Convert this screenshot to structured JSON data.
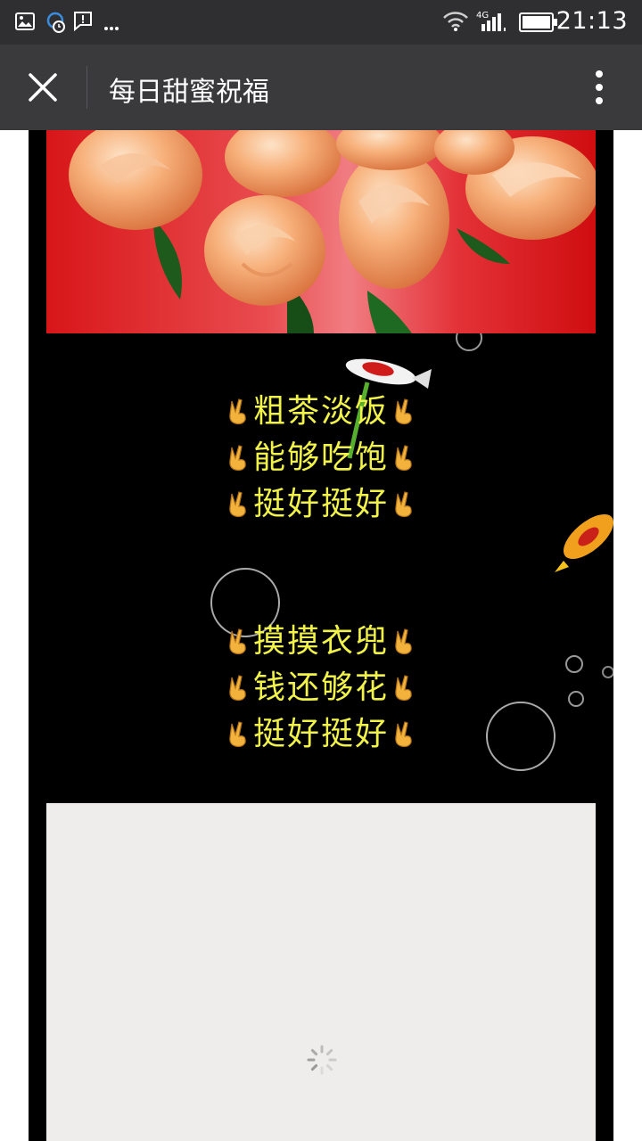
{
  "status_bar": {
    "time": "21:13",
    "network": "4G",
    "left_icons": [
      "image-icon",
      "sync-icon",
      "message-icon",
      "more-dots-icon"
    ],
    "right_icons": [
      "wifi-icon",
      "signal-icon",
      "battery-icon"
    ]
  },
  "nav": {
    "title": "每日甜蜜祝福",
    "close_icon": "close-icon",
    "more_icon": "vertical-dots-icon"
  },
  "poem": {
    "stanza1": [
      "粗茶淡饭",
      "能够吃饱",
      "挺好挺好"
    ],
    "stanza2": [
      "摸摸衣兜",
      "钱还够花",
      "挺好挺好"
    ],
    "decoration": "✌"
  },
  "colors": {
    "status_bar_bg": "#2f2f31",
    "nav_bg": "#3a3a3c",
    "poem_text": "#f1f24a",
    "rose_bg": "#d81619",
    "loading_bg": "#eeedeb"
  }
}
